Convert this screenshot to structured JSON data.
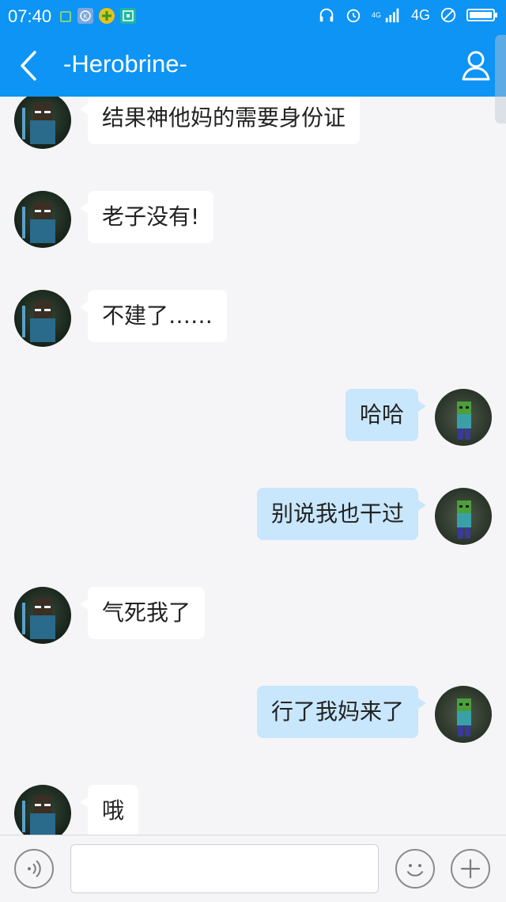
{
  "status_bar": {
    "time": "07:40",
    "network_label": "4G",
    "network_label_small": "4G",
    "icons_left": [
      "notification-icon",
      "k-app-icon",
      "plus-app-icon",
      "scan-app-icon"
    ],
    "icons_right": [
      "headphone-icon",
      "alarm-icon",
      "signal-icon",
      "no-disturb-icon",
      "battery-icon"
    ]
  },
  "header": {
    "title": "-Herobrine-",
    "back_icon": "chevron-left-icon",
    "profile_icon": "person-icon"
  },
  "messages": [
    {
      "side": "left",
      "text": "结果神他妈的需要身份证"
    },
    {
      "side": "left",
      "text": "老子没有!"
    },
    {
      "side": "left",
      "text": "不建了……"
    },
    {
      "side": "right",
      "text": "哈哈"
    },
    {
      "side": "right",
      "text": "别说我也干过"
    },
    {
      "side": "left",
      "text": "气死我了"
    },
    {
      "side": "right",
      "text": "行了我妈来了"
    },
    {
      "side": "left",
      "text": "哦"
    }
  ],
  "input_bar": {
    "voice_icon": "voice-icon",
    "emoji_icon": "smiley-icon",
    "add_icon": "plus-icon",
    "input_value": ""
  },
  "colors": {
    "header_bg": "#0d94f4",
    "incoming_bubble": "#ffffff",
    "outgoing_bubble": "#c8e6fc",
    "chat_bg": "#f5f5f7"
  }
}
